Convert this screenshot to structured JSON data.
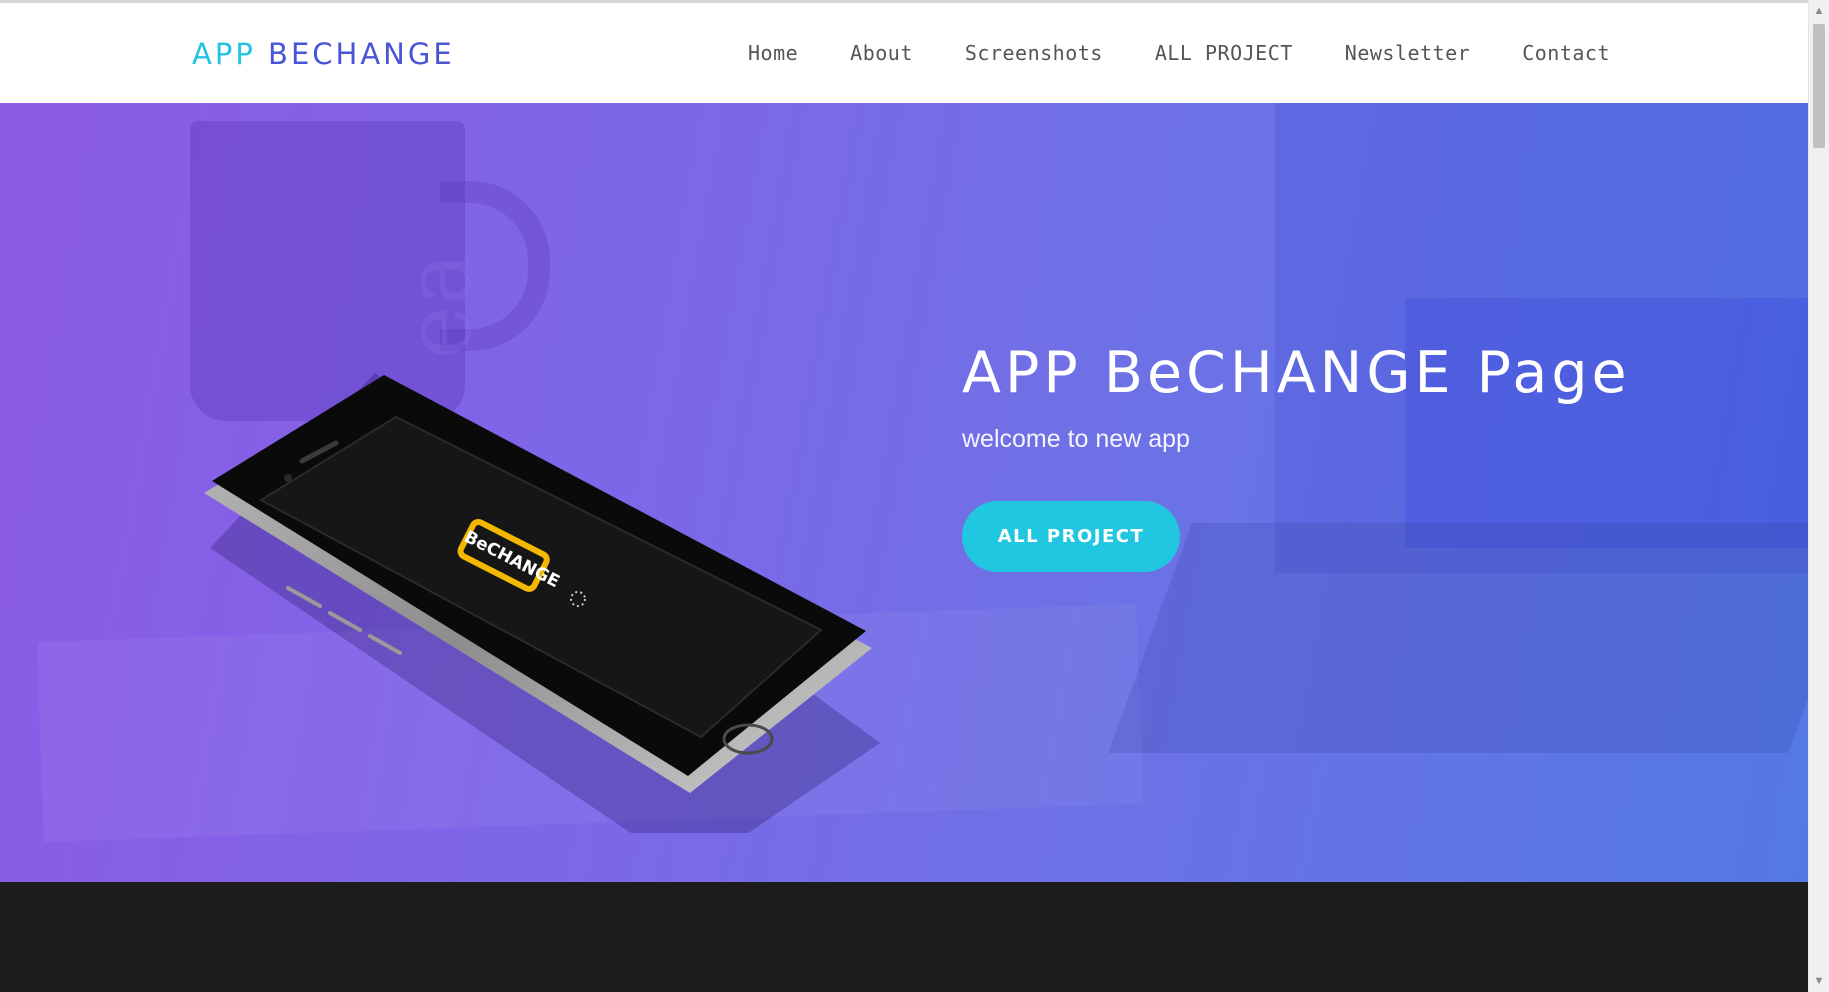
{
  "header": {
    "logo_word_1": "APP",
    "logo_word_2": "BECHANGE",
    "nav": [
      {
        "label": "Home"
      },
      {
        "label": "About"
      },
      {
        "label": "Screenshots"
      },
      {
        "label": "ALL PROJECT"
      },
      {
        "label": "Newsletter"
      },
      {
        "label": "Contact"
      }
    ]
  },
  "hero": {
    "title": "APP BeCHANGE Page",
    "subtitle": "welcome to new app",
    "cta_label": "ALL PROJECT",
    "phone_logo_text": "BeCHANGE",
    "background_decor_text": "ea"
  },
  "colors": {
    "logo_accent": "#23c3e0",
    "logo_primary": "#4a54d6",
    "gradient_start": "#8c5be6",
    "gradient_end": "#5479e6",
    "cta": "#21c6e0",
    "footer": "#1c1c1c",
    "phone_logo": "#f5b800"
  },
  "icons": {
    "scroll_up": "chevron-up-icon",
    "scroll_down": "chevron-down-icon",
    "loading": "spinner-icon"
  }
}
